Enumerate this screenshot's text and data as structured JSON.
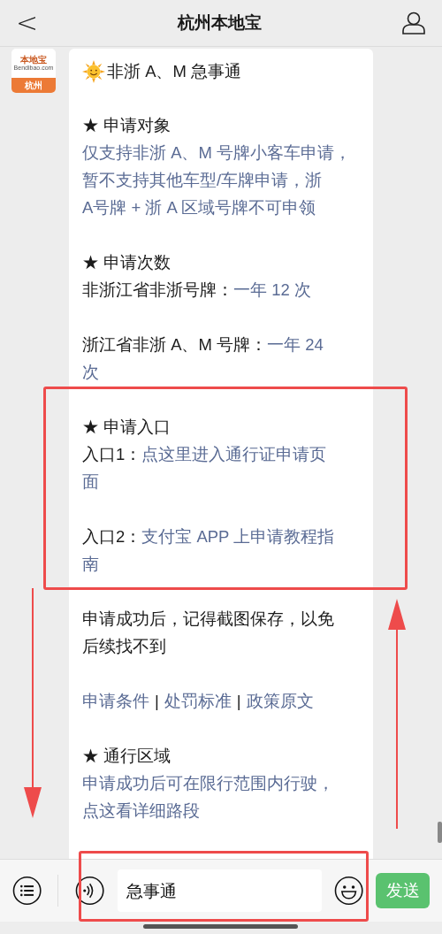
{
  "nav_bar": {
    "back": "<",
    "title": "杭州本地宝"
  },
  "avatar": {
    "brand": "本地宝",
    "domain": "Bendibao.com",
    "city": "杭州"
  },
  "message": {
    "heading": "非浙 A、M 急事通",
    "groups": [
      {
        "lines": [
          [
            {
              "kind": "plain",
              "text": "★ 申请对象"
            }
          ],
          [
            {
              "kind": "link",
              "text": "仅支持非浙 A、M 号牌小客车申请，"
            }
          ],
          [
            {
              "kind": "link",
              "text": "暂不支持其他车型/车牌申请，浙"
            }
          ],
          [
            {
              "kind": "link",
              "text": "A号牌 + 浙 A 区域号牌不可申领"
            }
          ]
        ]
      },
      {
        "lines": [
          [
            {
              "kind": "plain",
              "text": "★ 申请次数"
            }
          ],
          [
            {
              "kind": "plain",
              "text": "非浙江省非浙号牌："
            },
            {
              "kind": "link",
              "text": "一年 12 次"
            }
          ]
        ]
      },
      {
        "lines": [
          [
            {
              "kind": "plain",
              "text": "浙江省非浙 A、M 号牌："
            },
            {
              "kind": "link",
              "text": "一年 24"
            }
          ],
          [
            {
              "kind": "link",
              "text": "次"
            }
          ]
        ]
      },
      {
        "lines": [
          [
            {
              "kind": "plain",
              "text": "★ 申请入口"
            }
          ],
          [
            {
              "kind": "plain",
              "text": "入口1："
            },
            {
              "kind": "link",
              "text": "点这里进入通行证申请页"
            }
          ],
          [
            {
              "kind": "link",
              "text": "面"
            }
          ]
        ]
      },
      {
        "lines": [
          [
            {
              "kind": "plain",
              "text": "入口2："
            },
            {
              "kind": "link",
              "text": "支付宝 APP 上申请教程指"
            }
          ],
          [
            {
              "kind": "link",
              "text": "南"
            }
          ]
        ]
      },
      {
        "lines": [
          [
            {
              "kind": "plain",
              "text": "申请成功后，记得截图保存，以免"
            }
          ],
          [
            {
              "kind": "plain",
              "text": "后续找不到"
            }
          ]
        ]
      },
      {
        "lines": [
          [
            {
              "kind": "link",
              "text": "申请条件"
            },
            {
              "kind": "separator",
              "text": "|"
            },
            {
              "kind": "link",
              "text": "处罚标准"
            },
            {
              "kind": "separator",
              "text": "|"
            },
            {
              "kind": "link",
              "text": "政策原文"
            }
          ]
        ]
      },
      {
        "lines": [
          [
            {
              "kind": "plain",
              "text": "★ 通行区域"
            }
          ],
          [
            {
              "kind": "link",
              "text": "申请成功后可在限行范围内行驶，"
            }
          ],
          [
            {
              "kind": "link",
              "text": "点这看详细路段"
            }
          ]
        ]
      }
    ]
  },
  "input_bar": {
    "value": "急事通",
    "send": "发送"
  },
  "annotations": [
    {
      "kind": "box"
    },
    {
      "kind": "box"
    },
    {
      "kind": "arrow-down"
    },
    {
      "kind": "arrow-up"
    }
  ]
}
